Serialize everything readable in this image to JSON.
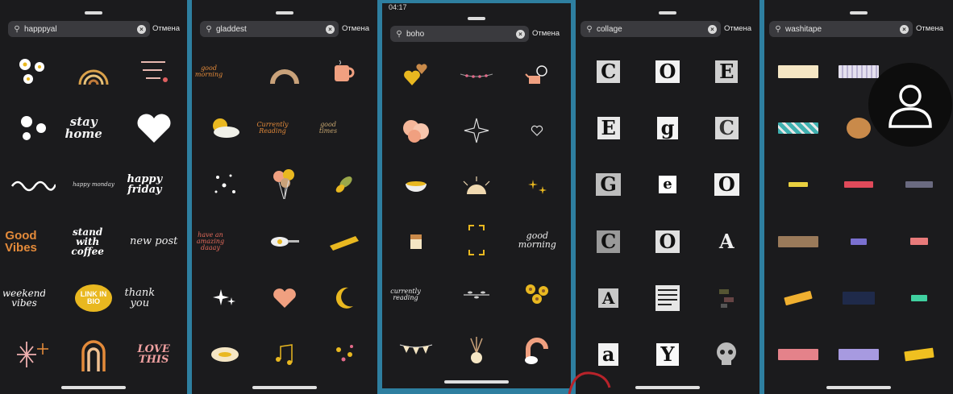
{
  "status": {
    "time": "04:17"
  },
  "cancel_label": "Отмена",
  "panels": [
    {
      "query": "happpyal",
      "stickers": {
        "r2c2": "stay home",
        "r3c2": "happy monday",
        "r3c3": "happy friday",
        "r4c1": "Good Vibes",
        "r4c2": "stand with coffee",
        "r4c3": "new post",
        "r5c1": "weekend vibes",
        "r5c2": "LINK IN BIO",
        "r5c3": "thank you",
        "r6c3": "LOVE THIS"
      }
    },
    {
      "query": "gladdest",
      "stickers": {
        "r1c1": "good morning",
        "r2c2": "Currently Reading",
        "r2c3": "good times",
        "r4c1": "have an amazing daaay"
      }
    },
    {
      "query": "boho",
      "stickers": {
        "r4c3": "good morning",
        "r5c1": "currently reading"
      }
    },
    {
      "query": "collage",
      "letters": [
        "C",
        "O",
        "E",
        "E",
        "g",
        "C",
        "G",
        "e",
        "O",
        "C",
        "O",
        "A",
        "A",
        "",
        "",
        "a",
        "Y",
        ""
      ]
    },
    {
      "query": "washitape"
    }
  ],
  "colors": {
    "background": "#2e7fa0",
    "panel": "#1b1b1d",
    "search_field": "#3a3a3e",
    "accent_yellow": "#e9b820",
    "accent_orange": "#e38a3a"
  }
}
